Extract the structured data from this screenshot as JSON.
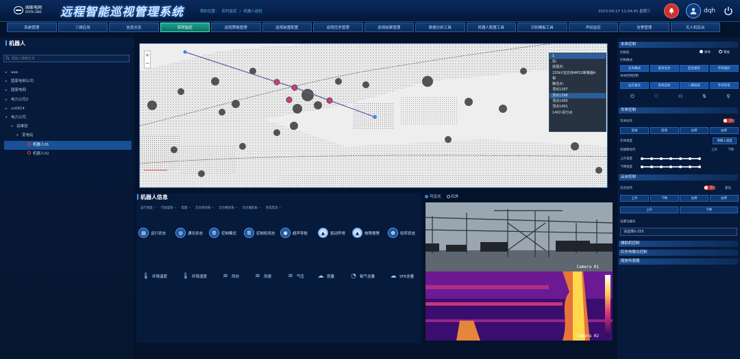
{
  "header": {
    "logo_text": "国家电网",
    "logo_sub": "STATE GRID",
    "title": "远程智能巡视管理系统",
    "breadcrumb": [
      "我的位置：",
      "实时监控",
      "/",
      "机器人巡检"
    ],
    "datetime": "2023-09-27 11:04:45 星期三",
    "username": "dqh"
  },
  "nav": {
    "tabs": [
      "系统管理",
      "三维应用",
      "信息总览",
      "实时监控",
      "巡视策略管理",
      "巡视装置配置",
      "巡视任务管理",
      "巡视结果管理",
      "数据分析工具",
      "机器人配置工具",
      "识别模板工具",
      "声纹监控",
      "告警管理",
      "无人机后台"
    ],
    "active_index": 3
  },
  "left": {
    "title": "机器人",
    "search_placeholder": "请输入搜索文本",
    "tree": [
      {
        "label": "aaa",
        "level": 0,
        "arrow": "▸"
      },
      {
        "label": "国家电网公司",
        "level": 0,
        "arrow": "▸"
      },
      {
        "label": "国家电网",
        "level": 0,
        "arrow": "▸"
      },
      {
        "label": "电力公司2",
        "level": 0,
        "arrow": "▸"
      },
      {
        "label": "cs0914",
        "level": 0,
        "arrow": "▸"
      },
      {
        "label": "电力公司",
        "level": 0,
        "arrow": "▾"
      },
      {
        "label": "运维班",
        "level": 1,
        "arrow": "▾"
      },
      {
        "label": "变电站",
        "level": 2,
        "arrow": "▾"
      },
      {
        "label": "机器人01",
        "level": 3,
        "arrow": "",
        "selected": true
      },
      {
        "label": "机器人02",
        "level": 3,
        "arrow": ""
      }
    ]
  },
  "map": {
    "popup_header": "1",
    "popup_lines": [
      "站：",
      "巡视点：",
      "220kV宝达线4M32断路器A",
      "相",
      "路径点：",
      "顶点1397",
      "顶点1398",
      "顶点1400",
      "顶点1401",
      "1402-拆分点"
    ],
    "popup_highlight": 6,
    "zoom_in": "+",
    "zoom_out": "−"
  },
  "info": {
    "title": "机器人信息",
    "stats": [
      "运行速度 --",
      "行驶里程 --",
      "电量 --",
      "云台俯仰角 --",
      "云台横滚角 --",
      "云台偏航角 --",
      "充电电流 --"
    ],
    "status_items": [
      "运行状态",
      "通讯状态",
      "控制模式",
      "控制权状态",
      "超声导航",
      "驱动异常",
      "故障报警",
      "轮转状态"
    ],
    "env_items": [
      "环境温度",
      "环境湿度",
      "风向",
      "风速",
      "气压",
      "雨量",
      "氧气含量",
      "SF6含量"
    ]
  },
  "camera": {
    "toggle": [
      "可见光",
      "红外"
    ],
    "active": 0,
    "visible_label": "Camera 01",
    "thermal_label": "Camera 02"
  },
  "right": {
    "sections": [
      "本体控制",
      "车体控制",
      "云台控制",
      "辅助机控制",
      "红外热像仪控制",
      "局放传感器"
    ],
    "control_right_label": "控制权",
    "control_right_options": [
      "抢夺",
      "释放"
    ],
    "control_mode_label": "控制模式",
    "control_modes": [
      "任务模式",
      "紧急任务",
      "后台遥控",
      "手持遥控"
    ],
    "body_control_label": "本体控制控制",
    "body_controls": [
      "远方复位",
      "系统自检",
      "一键返航",
      "手动充电"
    ],
    "vehicle_action_label": "车体动作",
    "vehicle_stop": "停止",
    "vehicle_dirs": [
      "前进",
      "后退",
      "左转",
      "右转"
    ],
    "vehicle_speed_label": "车体速度",
    "vehicle_speed_btn": "请输入速度",
    "lift_label": "机械臂动作",
    "lift_up": "上升",
    "lift_down": "下降",
    "up_speed_label": "上升速度",
    "down_speed_label": "下降速度",
    "ptz_action_label": "云台动作",
    "ptz_stop": "停止",
    "ptz_reset": "复位",
    "ptz_dirs": [
      "左上",
      "上",
      "右上",
      "左",
      "右"
    ],
    "ptz_dirs_row1": [
      "上升",
      "下降",
      "左转",
      "右转"
    ],
    "ptz_dirs_row2": [
      "上升",
      "下降"
    ],
    "preset_label": "设置位编号",
    "preset_placeholder": "请选择0-255"
  }
}
